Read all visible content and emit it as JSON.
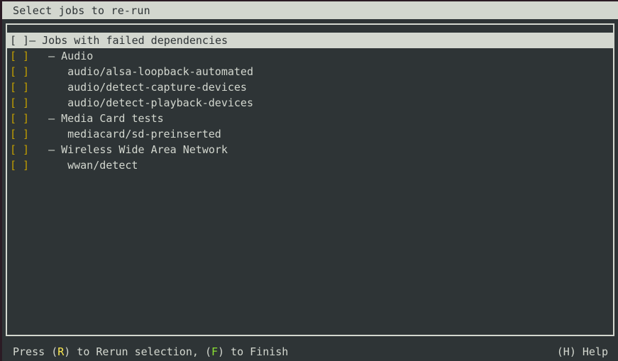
{
  "window": {
    "title": "Select jobs to re-run"
  },
  "colors": {
    "background": "#2e3436",
    "foreground": "#d3d7cf",
    "selection_bg": "#d3d7cf",
    "selection_fg": "#2e3436",
    "key_rerun": "#fce94f",
    "key_finish": "#8ae234",
    "checkbox": "#c4a000",
    "edge": "#2b1b24"
  },
  "joblist": {
    "rows": [
      {
        "checkbox": "[ ]",
        "checked": false,
        "indent": 0,
        "label": "– Jobs with failed dependencies",
        "selected": true
      },
      {
        "checkbox": "[ ]",
        "checked": false,
        "indent": 1,
        "label": "– Audio",
        "selected": false
      },
      {
        "checkbox": "[ ]",
        "checked": false,
        "indent": 2,
        "label": "audio/alsa-loopback-automated",
        "selected": false
      },
      {
        "checkbox": "[ ]",
        "checked": false,
        "indent": 2,
        "label": "audio/detect-capture-devices",
        "selected": false
      },
      {
        "checkbox": "[ ]",
        "checked": false,
        "indent": 2,
        "label": "audio/detect-playback-devices",
        "selected": false
      },
      {
        "checkbox": "[ ]",
        "checked": false,
        "indent": 1,
        "label": "– Media Card tests",
        "selected": false
      },
      {
        "checkbox": "[ ]",
        "checked": false,
        "indent": 2,
        "label": "mediacard/sd-preinserted",
        "selected": false
      },
      {
        "checkbox": "[ ]",
        "checked": false,
        "indent": 1,
        "label": "– Wireless Wide Area Network",
        "selected": false
      },
      {
        "checkbox": "[ ]",
        "checked": false,
        "indent": 2,
        "label": "wwan/detect",
        "selected": false
      }
    ]
  },
  "statusbar": {
    "left": {
      "press_word": "Press ",
      "rerun_open": "(",
      "rerun_key": "R",
      "rerun_close": ")",
      "rerun_text": " to Rerun selection, ",
      "finish_open": "(",
      "finish_key": "F",
      "finish_close": ")",
      "finish_text": " to Finish"
    },
    "right": {
      "help_open": "(",
      "help_key": "H",
      "help_close": ")",
      "help_text": " Help"
    }
  }
}
